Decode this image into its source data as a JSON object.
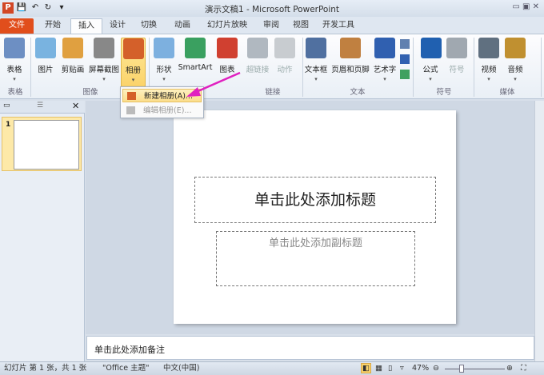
{
  "window": {
    "title": "演示文稿1 - Microsoft PowerPoint"
  },
  "quick_access": [
    {
      "icon": "powerpoint-logo-icon",
      "glyph": "P"
    },
    {
      "icon": "save-icon",
      "glyph": "💾"
    },
    {
      "icon": "undo-icon",
      "glyph": "↶"
    },
    {
      "icon": "redo-icon",
      "glyph": "↻"
    },
    {
      "icon": "customize-icon",
      "glyph": "▾"
    }
  ],
  "tabs": [
    "文件",
    "开始",
    "插入",
    "设计",
    "切换",
    "动画",
    "幻灯片放映",
    "审阅",
    "视图",
    "开发工具"
  ],
  "active_tab": "插入",
  "ribbon": {
    "buttons": [
      {
        "label": "表格",
        "icon": "table-icon",
        "color": "#6d8fc3",
        "dd": "▾"
      },
      {
        "label": "图片",
        "icon": "picture-icon",
        "color": "#79b3e0",
        "dd": ""
      },
      {
        "label": "剪贴画",
        "icon": "clipart-icon",
        "color": "#e0a040",
        "dd": ""
      },
      {
        "label": "屏幕截图",
        "icon": "screenshot-icon",
        "color": "#888",
        "dd": "▾"
      },
      {
        "label": "相册",
        "icon": "photo-album-icon",
        "color": "#d4602a",
        "dd": "▾"
      },
      {
        "label": "形状",
        "icon": "shapes-icon",
        "color": "#7db0df",
        "dd": "▾"
      },
      {
        "label": "SmartArt",
        "icon": "smartart-icon",
        "color": "#3aa060",
        "dd": ""
      },
      {
        "label": "图表",
        "icon": "chart-icon",
        "color": "#d04030",
        "dd": ""
      },
      {
        "label": "超链接",
        "icon": "hyperlink-icon",
        "color": "#b0b8c0",
        "dd": ""
      },
      {
        "label": "动作",
        "icon": "action-icon",
        "color": "#c8ccd0",
        "dd": ""
      },
      {
        "label": "文本框",
        "icon": "textbox-icon",
        "color": "#5070a0",
        "dd": "▾"
      },
      {
        "label": "页眉和页脚",
        "icon": "header-footer-icon",
        "color": "#c08040",
        "dd": ""
      },
      {
        "label": "艺术字",
        "icon": "wordart-icon",
        "color": "#3060b0",
        "dd": "▾"
      },
      {
        "label": "公式",
        "icon": "equation-icon",
        "color": "#2060b0",
        "dd": "▾"
      },
      {
        "label": "符号",
        "icon": "symbol-icon",
        "color": "#a0a8b0",
        "dd": ""
      },
      {
        "label": "视频",
        "icon": "video-icon",
        "color": "#607080",
        "dd": "▾"
      },
      {
        "label": "音频",
        "icon": "audio-icon",
        "color": "#c09030",
        "dd": "▾"
      }
    ],
    "groups": [
      "表格",
      "图像",
      "链接",
      "文本",
      "符号",
      "媒体"
    ]
  },
  "album_menu": {
    "items": [
      {
        "label": "新建相册(A)...",
        "enabled": true
      },
      {
        "label": "编辑相册(E)...",
        "enabled": false
      }
    ]
  },
  "slides_panel": {
    "slide_number": "1"
  },
  "slide": {
    "title_placeholder": "单击此处添加标题",
    "subtitle_placeholder": "单击此处添加副标题"
  },
  "notes": {
    "placeholder": "单击此处添加备注"
  },
  "status": {
    "slide_info": "幻灯片 第 1 张，共 1 张",
    "theme": "\"Office 主题\"",
    "language": "中文(中国)",
    "zoom": "47%",
    "zoom_percent": 47
  },
  "colors": {
    "file_tab": "#e14e1c",
    "highlight": "#fbd36a",
    "arrow": "#e020c0"
  }
}
